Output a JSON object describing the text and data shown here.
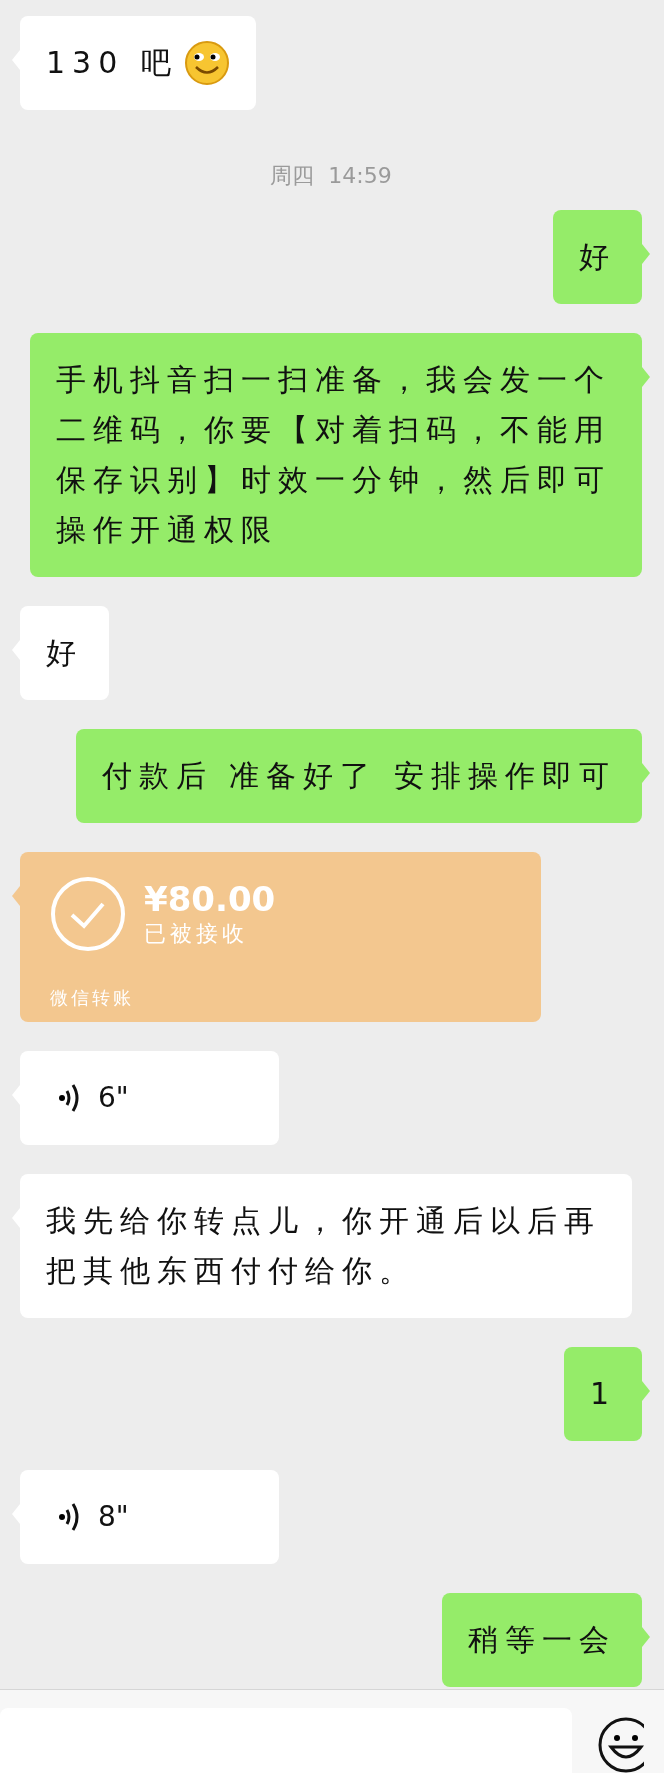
{
  "messages": [
    {
      "kind": "text",
      "outgoing": false,
      "text": "130 吧",
      "emoji": true
    },
    {
      "kind": "time",
      "text": "周四  14:59"
    },
    {
      "kind": "text",
      "outgoing": true,
      "text": "好"
    },
    {
      "kind": "text",
      "outgoing": true,
      "text": "手机抖音扫一扫准备，我会发一个二维码，你要【对着扫码，不能用保存识别】时效一分钟，然后即可操作开通权限"
    },
    {
      "kind": "text",
      "outgoing": false,
      "text": "好"
    },
    {
      "kind": "text",
      "outgoing": true,
      "text": "付款后  准备好了  安排操作即可"
    },
    {
      "kind": "transfer",
      "outgoing": false,
      "amount": "¥80.00",
      "status": "已被接收",
      "footer": "微信转账"
    },
    {
      "kind": "voice",
      "outgoing": false,
      "duration": "6\""
    },
    {
      "kind": "text",
      "outgoing": false,
      "text": "我先给你转点儿，你开通后以后再把其他东西付付给你。"
    },
    {
      "kind": "text",
      "outgoing": true,
      "text": "1"
    },
    {
      "kind": "voice",
      "outgoing": false,
      "duration": "8\""
    },
    {
      "kind": "text",
      "outgoing": true,
      "text": "稍等一会"
    }
  ]
}
